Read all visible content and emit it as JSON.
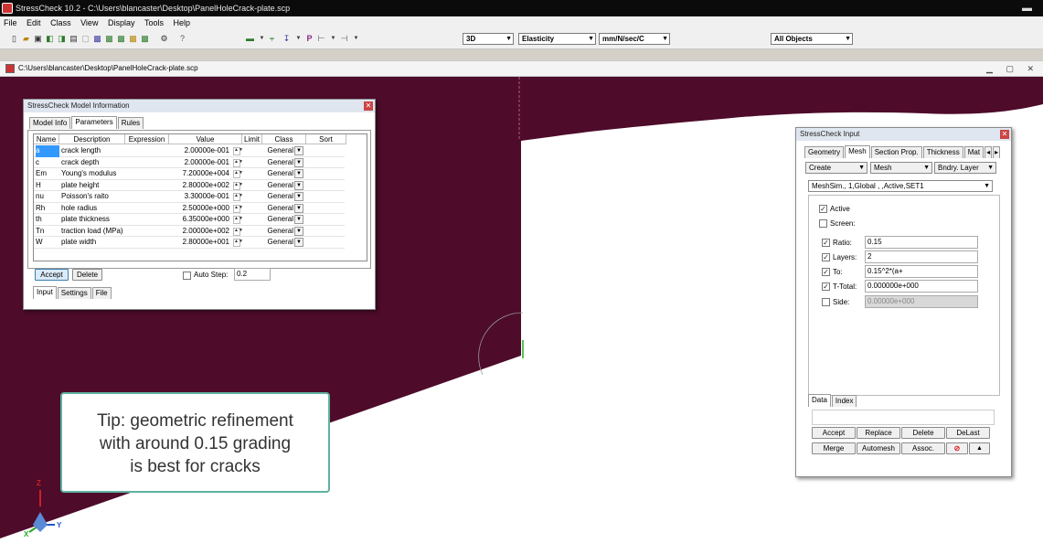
{
  "app": {
    "title": "StressCheck 10.2 - C:\\Users\\blancaster\\Desktop\\PanelHoleCrack-plate.scp",
    "menu": [
      "File",
      "Edit",
      "Class",
      "View",
      "Display",
      "Tools",
      "Help"
    ],
    "doc_path": "C:\\Users\\blancaster\\Desktop\\PanelHoleCrack-plate.scp",
    "colors": {
      "plate": "#4e0b2a",
      "accent_tip_border": "#5fb2a0",
      "selection": "#3399ff"
    }
  },
  "toolbar": {
    "view_mode": "3D",
    "analysis": "Elasticity",
    "units": "mm/N/sec/C",
    "objects": "All Objects"
  },
  "model_info": {
    "title": "StressCheck Model Information",
    "tabs": [
      "Model Info",
      "Parameters",
      "Rules"
    ],
    "columns": [
      "Name",
      "Description",
      "Expression",
      "Value",
      "Limit",
      "Class",
      "Sort"
    ],
    "rows": [
      {
        "name": "a",
        "description": "crack length",
        "value": "2.00000e-001",
        "class": "General"
      },
      {
        "name": "c",
        "description": "crack depth",
        "value": "2.00000e-001",
        "class": "General"
      },
      {
        "name": "Em",
        "description": "Young's modulus",
        "value": "7.20000e+004",
        "class": "General"
      },
      {
        "name": "H",
        "description": "plate height",
        "value": "2.80000e+002",
        "class": "General"
      },
      {
        "name": "nu",
        "description": "Poisson's raito",
        "value": "3.30000e-001",
        "class": "General"
      },
      {
        "name": "Rh",
        "description": "hole radius",
        "value": "2.50000e+000",
        "class": "General"
      },
      {
        "name": "th",
        "description": "plate thickness",
        "value": "6.35000e+000",
        "class": "General"
      },
      {
        "name": "Tn",
        "description": "traction load (MPa)",
        "value": "2.00000e+002",
        "class": "General"
      },
      {
        "name": "W",
        "description": "plate width",
        "value": "2.80000e+001",
        "class": "General"
      }
    ],
    "accept_label": "Accept",
    "delete_label": "Delete",
    "auto_step_label": "Auto Step:",
    "auto_step_value": "0.2",
    "bottom_tabs": [
      "Input",
      "Settings",
      "File"
    ]
  },
  "input_panel": {
    "title": "StressCheck Input",
    "tabs": [
      "Geometry",
      "Mesh",
      "Section Prop.",
      "Thickness",
      "Mat"
    ],
    "action": "Create",
    "category": "Mesh",
    "subcategory": "Bndry. Layer",
    "record": "MeshSim., 1,Global , ,Active,SET1",
    "active_label": "Active",
    "screen_label": "Screen:",
    "ratio_label": "Ratio:",
    "ratio_value": "0.15",
    "layers_label": "Layers:",
    "layers_value": "2",
    "to_label": "To:",
    "to_value": "0.15^2*(a+",
    "ttotal_label": "T-Total:",
    "ttotal_value": "0.000000e+000",
    "side_label": "Side:",
    "side_value": "0.00000e+000",
    "bottom_tabs": [
      "Data",
      "Index"
    ],
    "buttons_row1": [
      "Accept",
      "Replace",
      "Delete",
      "DeLast"
    ],
    "buttons_row2": [
      "Merge",
      "Automesh",
      "Assoc."
    ]
  },
  "tip": {
    "line1": "Tip: geometric refinement",
    "line2": "with around 0.15 grading",
    "line3": "is best for cracks"
  },
  "axes": {
    "x": "X",
    "y": "Y",
    "z": "Z"
  }
}
